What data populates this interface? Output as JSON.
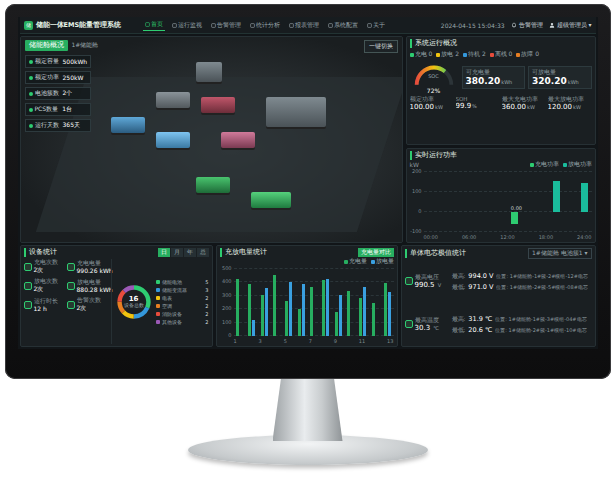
{
  "app": {
    "title": "储能一体EMS能量管理系统",
    "logo": "储",
    "nav": [
      {
        "label": "首页",
        "selected": true
      },
      {
        "label": "运行监视",
        "selected": false
      },
      {
        "label": "告警管理",
        "selected": false
      },
      {
        "label": "统计分析",
        "selected": false
      },
      {
        "label": "报表管理",
        "selected": false
      },
      {
        "label": "系统配置",
        "selected": false
      },
      {
        "label": "关于",
        "selected": false
      }
    ],
    "datetime": "2024-04-15 15:04:33",
    "alarm": "告警管理",
    "user": "超级管理员",
    "caret": "▾"
  },
  "scene": {
    "title": "储能舱概况",
    "tag": "1#储能舱",
    "switch": "一键切换",
    "items": [
      {
        "label": "额定容量",
        "value": "500kWh"
      },
      {
        "label": "额定功率",
        "value": "250kW"
      },
      {
        "label": "电池簇数",
        "value": "2个"
      },
      {
        "label": "PCS数量",
        "value": "1台"
      },
      {
        "label": "运行天数",
        "value": "365天"
      }
    ]
  },
  "overview": {
    "title": "系统运行概况",
    "states": [
      {
        "label": "充电",
        "count": "0",
        "color": "#2ecc71"
      },
      {
        "label": "放电",
        "count": "2",
        "color": "#f1c40f"
      },
      {
        "label": "待机",
        "count": "2",
        "color": "#3498db"
      },
      {
        "label": "离线",
        "count": "0",
        "color": "#e74c3c"
      },
      {
        "label": "故障",
        "count": "0",
        "color": "#e67e22"
      }
    ],
    "gauge": {
      "label": "SOC",
      "value": "72%",
      "level": 0.72
    },
    "big": [
      {
        "label": "可充电量",
        "value": "380.20",
        "unit": "kWh"
      },
      {
        "label": "可放电量",
        "value": "320.20",
        "unit": "kWh"
      }
    ],
    "small": [
      {
        "label": "额定功率",
        "value": "100.00",
        "unit": "kW"
      },
      {
        "label": "SOH",
        "value": "99.9",
        "unit": "%"
      },
      {
        "label": "最大充电功率",
        "value": "360.00",
        "unit": "kW"
      },
      {
        "label": "最大放电功率",
        "value": "120.00",
        "unit": "kW"
      }
    ]
  },
  "power_chart": {
    "title": "实时运行功率",
    "unit": "kW",
    "legend": [
      {
        "label": "充电功率",
        "color": "#2ecc71"
      },
      {
        "label": "放电功率",
        "color": "#1abc9c"
      }
    ],
    "y_ticks": [
      "200",
      "100",
      "0",
      "-100"
    ],
    "x_ticks": [
      "00:00",
      "06:00",
      "12:00",
      "18:00",
      "24:00"
    ],
    "series": [
      [
        0,
        0,
        0,
        0,
        0,
        0,
        -60,
        0,
        0,
        0,
        0,
        0
      ],
      [
        0,
        0,
        0,
        0,
        0,
        0,
        0,
        0,
        0,
        150,
        0,
        140
      ]
    ],
    "marker": "0.00"
  },
  "device_stats": {
    "title": "设备统计",
    "tabs": [
      {
        "label": "日",
        "selected": true
      },
      {
        "label": "月",
        "selected": false
      },
      {
        "label": "年",
        "selected": false
      },
      {
        "label": "总",
        "selected": false
      }
    ],
    "stats": [
      {
        "label": "充电次数",
        "value": "2次"
      },
      {
        "label": "充电电量",
        "value": "990.26 kWh"
      },
      {
        "label": "放电次数",
        "value": "2次"
      },
      {
        "label": "放电电量",
        "value": "880.28 kWh"
      },
      {
        "label": "运行时长",
        "value": "12 h"
      },
      {
        "label": "告警次数",
        "value": "2次"
      }
    ],
    "donut": {
      "label": "设备总数",
      "total": "16",
      "segments": [
        {
          "label": "储能电池",
          "count": 5,
          "color": "#2ecc71"
        },
        {
          "label": "储能变流器",
          "count": 3,
          "color": "#3498db"
        },
        {
          "label": "电表",
          "count": 2,
          "color": "#f1c40f"
        },
        {
          "label": "空调",
          "count": 2,
          "color": "#e67e22"
        },
        {
          "label": "消防设备",
          "count": 2,
          "color": "#e74c3c"
        },
        {
          "label": "其他设备",
          "count": 2,
          "color": "#9b59b6"
        }
      ]
    }
  },
  "energy_chart": {
    "title": "充放电量统计",
    "toggle": "充电量对比",
    "legend": [
      {
        "label": "充电量",
        "color": "#27ae60"
      },
      {
        "label": "放电量",
        "color": "#3aa0e0"
      }
    ],
    "y_ticks": [
      "500",
      "400",
      "300",
      "200",
      "100",
      "0"
    ],
    "x_ticks": [
      "1",
      "3",
      "5",
      "7",
      "9",
      "11",
      "13"
    ],
    "series": [
      [
        420,
        380,
        300,
        450,
        260,
        200,
        360,
        410,
        180,
        330,
        280,
        240,
        390
      ],
      [
        0,
        120,
        350,
        0,
        400,
        380,
        0,
        420,
        300,
        0,
        360,
        0,
        320
      ]
    ]
  },
  "cell_stats": {
    "title": "单体电芯极值统计",
    "select": "1#储能舱 电池簇1",
    "caret": "▾",
    "groups": [
      {
        "label": "最高电压",
        "value": "990.5",
        "unit": "V",
        "rows": [
          {
            "label": "最高:",
            "value": "994.0 V",
            "location": "位置: 1#储能舱-1#簇-2#模组-12#电芯"
          },
          {
            "label": "最低:",
            "value": "971.0 V",
            "location": "位置: 1#储能舱-2#簇-5#模组-08#电芯"
          }
        ]
      },
      {
        "label": "最高温度",
        "value": "30.3",
        "unit": "℃",
        "rows": [
          {
            "label": "最高:",
            "value": "31.9 ℃",
            "location": "位置: 1#储能舱-1#簇-3#模组-04#电芯"
          },
          {
            "label": "最低:",
            "value": "20.6 ℃",
            "location": "位置: 1#储能舱-2#簇-1#模组-10#电芯"
          }
        ]
      }
    ]
  }
}
